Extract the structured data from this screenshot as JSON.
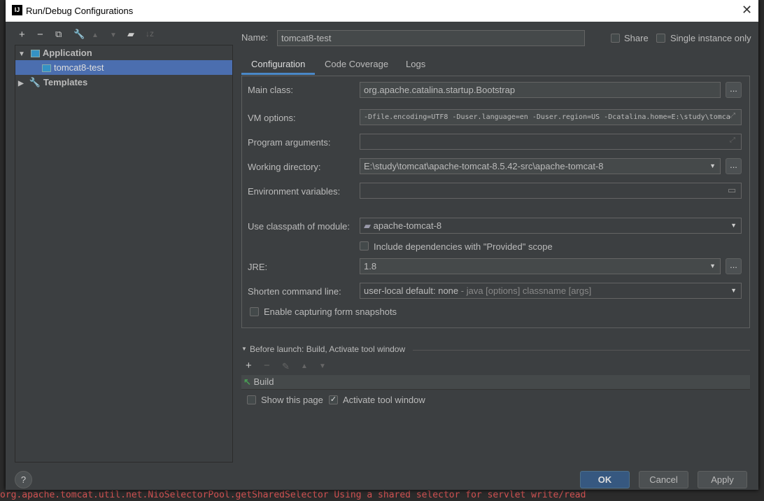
{
  "window": {
    "title": "Run/Debug Configurations",
    "logo": "IJ"
  },
  "toolbar": {
    "icons": [
      "plus-icon",
      "minus-icon",
      "copy-icon",
      "wrench-icon",
      "arrow-up-icon",
      "arrow-down-icon",
      "folder-add-icon",
      "sort-icon"
    ]
  },
  "tree": {
    "items": [
      {
        "label": "Application",
        "expanded": true
      },
      {
        "label": "tomcat8-test",
        "selected": true
      },
      {
        "label": "Templates",
        "expanded": false
      }
    ]
  },
  "name": {
    "label": "Name:",
    "value": "tomcat8-test"
  },
  "share": {
    "label": "Share",
    "checked": false
  },
  "single_instance": {
    "label": "Single instance only",
    "checked": false
  },
  "tabs": [
    {
      "label": "Configuration",
      "active": true
    },
    {
      "label": "Code Coverage"
    },
    {
      "label": "Logs"
    }
  ],
  "form": {
    "main_class": {
      "label": "Main class:",
      "value": "org.apache.catalina.startup.Bootstrap"
    },
    "vm_options": {
      "label": "VM options:",
      "value": "-Dfile.encoding=UTF8 -Duser.language=en -Duser.region=US -Dcatalina.home=E:\\study\\tomca"
    },
    "program_arguments": {
      "label": "Program arguments:",
      "value": ""
    },
    "working_directory": {
      "label": "Working directory:",
      "value": "E:\\study\\tomcat\\apache-tomcat-8.5.42-src\\apache-tomcat-8"
    },
    "environment_variables": {
      "label": "Environment variables:",
      "value": ""
    },
    "classpath_module": {
      "label": "Use classpath of module:",
      "value": "apache-tomcat-8"
    },
    "include_dependencies": {
      "label": "Include dependencies with \"Provided\" scope",
      "checked": false
    },
    "jre": {
      "label": "JRE:",
      "value": "1.8"
    },
    "shorten_command_line": {
      "label": "Shorten command line:",
      "value": "user-local default: none",
      "hint": " - java [options] classname [args]"
    },
    "enable_snapshots": {
      "label": "Enable capturing form snapshots",
      "checked": false
    },
    "browse_label": "..."
  },
  "before_launch": {
    "title": "Before launch: Build, Activate tool window",
    "items": [
      "Build"
    ],
    "show_this_page": {
      "label": "Show this page",
      "checked": false
    },
    "activate_tool_window": {
      "label": "Activate tool window",
      "checked": true
    }
  },
  "buttons": {
    "help": "?",
    "ok": "OK",
    "cancel": "Cancel",
    "apply": "Apply"
  },
  "background_log": "org.apache.tomcat.util.net.NioSelectorPool.getSharedSelector Using a shared selector for servlet write/read"
}
